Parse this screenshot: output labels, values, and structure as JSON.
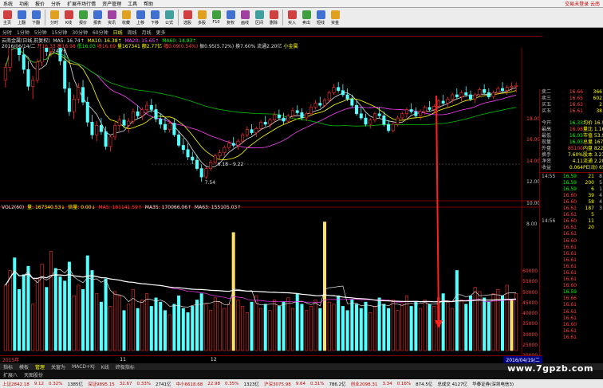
{
  "menu": {
    "items": [
      "系统",
      "功能",
      "报价",
      "分析",
      "扩展市场行情",
      "资产管理",
      "工具",
      "帮助"
    ],
    "right": "交易未登录  云南"
  },
  "toolbar": {
    "buttons": [
      {
        "label": "主页",
        "color": "#d04040"
      },
      {
        "label": "上翻",
        "color": "#4070d0"
      },
      {
        "label": "下翻",
        "color": "#4070d0"
      },
      {
        "label": "分时",
        "color": "#e0a020"
      },
      {
        "label": "K线",
        "color": "#d04040"
      },
      {
        "label": "报价",
        "color": "#40a040"
      },
      {
        "label": "报表",
        "color": "#4070d0"
      },
      {
        "label": "资讯",
        "color": "#a040a0"
      },
      {
        "label": "收藏",
        "color": "#e0a020"
      },
      {
        "label": "上移",
        "color": "#4070d0"
      },
      {
        "label": "下移",
        "color": "#4070d0"
      },
      {
        "label": "公式",
        "color": "#40a0a0"
      },
      {
        "label": "选股",
        "color": "#d04040"
      },
      {
        "label": "多股",
        "color": "#e0a020"
      },
      {
        "label": "F10",
        "color": "#40a040"
      },
      {
        "label": "复权",
        "color": "#4070d0"
      },
      {
        "label": "画线",
        "color": "#a040a0"
      },
      {
        "label": "区间",
        "color": "#40a0a0"
      },
      {
        "label": "删除",
        "color": "#d04040"
      },
      {
        "label": "买入",
        "color": "#d04040"
      },
      {
        "label": "卖出",
        "color": "#40a040"
      },
      {
        "label": "短线",
        "color": "#4070d0"
      },
      {
        "label": "资金",
        "color": "#e0a020"
      }
    ]
  },
  "periods": [
    "分时",
    "1分钟",
    "5分钟",
    "15分钟",
    "30分钟",
    "60分钟",
    "日线",
    "周线",
    "月线",
    "更多"
  ],
  "info": {
    "line1_name": "云南金属(日线,前复权)",
    "ma5": "MA5: 16.74↑",
    "ma10": "MA10: 16.38↑",
    "ma20": "MA20: 15.65↑",
    "ma60": "MA60: 14.93↑",
    "line2_date": "2016/06/14/二",
    "open": "开16.33",
    "high": "高16.98",
    "low": "低16.03",
    "close": "收16.69",
    "vol": "量167341",
    "amount": "额2.77亿",
    "chg": "幅0.09(0.54%)",
    "amp": "振0.95(5.72%)",
    "turn": "换7.60%",
    "flow": "流通2.20亿",
    "tag": "小金属"
  },
  "chart_labels": {
    "high_mark": "24.76",
    "low_mark": "7.54",
    "range_mark": "6.18 - 9.22"
  },
  "price_axis": [
    "18.00",
    "16.00",
    "14.00",
    "12.00",
    "10.00",
    "8.00"
  ],
  "vol_axis": [
    "60000",
    "55000",
    "50000",
    "45000",
    "40000",
    "35000",
    "30000",
    "25000",
    "20000",
    "15000",
    "10000"
  ],
  "vol_info": {
    "label": "VOL2(60)",
    "vol": "量: 167340.53↓",
    "ratio": "倍量: 0.00↓",
    "ma5": "MA5: 181141.59↑",
    "ma35": "MA35: 170066.06↑",
    "ma63": "MA63: 155105.03↑"
  },
  "quote": [
    {
      "k": "卖二",
      "v": "16.66",
      "n": "366",
      "vc": "#ff4040"
    },
    {
      "k": "卖三",
      "v": "16.65",
      "n": "602",
      "vc": "#ff4040"
    },
    {
      "k": "买五",
      "v": "16.63",
      "n": "2",
      "vc": "#ff4040"
    },
    {
      "k": "买五",
      "v": "16.61",
      "n": "38",
      "vc": "#ff4040"
    },
    {
      "k": "",
      "v": "",
      "n": "",
      "vc": "#000"
    },
    {
      "k": "今开",
      "v": "16.33",
      "n": "均价 16.53",
      "vc": "#00ff00"
    },
    {
      "k": "最高",
      "v": "16.98",
      "n": "量比 1.16",
      "vc": "#ff4040"
    },
    {
      "k": "最低",
      "v": "16.03",
      "n": "市值 53.9亿",
      "vc": "#00ff00"
    },
    {
      "k": "现量",
      "v": "16.03",
      "n": "总量 167340",
      "vc": "#00ff00"
    },
    {
      "k": "外盘",
      "v": "85100",
      "n": "内盘 82240",
      "vc": "#ff4040"
    },
    {
      "k": "换手",
      "v": "7.60%",
      "n": "股本 3.23亿",
      "vc": "#ffff00"
    },
    {
      "k": "净资",
      "v": "4.11",
      "n": "流通 2.20亿",
      "vc": "#ffff00"
    },
    {
      "k": "收益",
      "v": "0.064",
      "n": "PE(动) 65.4",
      "vc": "#ffff00"
    }
  ],
  "ticks": [
    {
      "t": "14:55",
      "p": "16.59",
      "q": "21",
      "s": "8",
      "pc": "#00ff00"
    },
    {
      "t": "",
      "p": "16.59",
      "q": "200",
      "s": "5",
      "pc": "#00ff00"
    },
    {
      "t": "",
      "p": "16.59",
      "q": "6",
      "s": "1",
      "pc": "#00ff00"
    },
    {
      "t": "",
      "p": "16.60",
      "q": "39",
      "s": "4",
      "pc": "#ff4040"
    },
    {
      "t": "",
      "p": "16.60",
      "q": "58",
      "s": "4",
      "pc": "#ff4040"
    },
    {
      "t": "",
      "p": "16.61",
      "q": "187",
      "s": "3",
      "pc": "#ff4040"
    },
    {
      "t": "",
      "p": "16.61",
      "q": "5",
      "s": "",
      "pc": "#ff4040"
    },
    {
      "t": "14:56",
      "p": "16.60",
      "q": "11",
      "s": "",
      "pc": "#ff4040"
    },
    {
      "t": "",
      "p": "16.61",
      "q": "20",
      "s": "",
      "pc": "#ff4040"
    },
    {
      "t": "",
      "p": "16.61",
      "q": "",
      "s": "",
      "pc": "#ff4040"
    },
    {
      "t": "",
      "p": "16.60",
      "q": "",
      "s": "",
      "pc": "#ff4040"
    },
    {
      "t": "",
      "p": "16.61",
      "q": "",
      "s": "",
      "pc": "#ff4040"
    },
    {
      "t": "",
      "p": "16.61",
      "q": "",
      "s": "",
      "pc": "#ff4040"
    },
    {
      "t": "",
      "p": "16.61",
      "q": "",
      "s": "",
      "pc": "#ff4040"
    },
    {
      "t": "",
      "p": "16.61",
      "q": "",
      "s": "",
      "pc": "#ff4040"
    },
    {
      "t": "",
      "p": "16.61",
      "q": "",
      "s": "",
      "pc": "#ff4040"
    },
    {
      "t": "",
      "p": "16.61",
      "q": "",
      "s": "",
      "pc": "#ff4040"
    },
    {
      "t": "",
      "p": "16.60",
      "q": "",
      "s": "",
      "pc": "#ff4040"
    },
    {
      "t": "",
      "p": "16.59",
      "q": "",
      "s": "",
      "pc": "#00ff00"
    },
    {
      "t": "",
      "p": "16.66",
      "q": "",
      "s": "",
      "pc": "#ff4040"
    },
    {
      "t": "",
      "p": "16.61",
      "q": "",
      "s": "",
      "pc": "#ff4040"
    },
    {
      "t": "",
      "p": "16.61",
      "q": "",
      "s": "",
      "pc": "#ff4040"
    },
    {
      "t": "",
      "p": "16.61",
      "q": "",
      "s": "",
      "pc": "#ff4040"
    },
    {
      "t": "",
      "p": "16.60",
      "q": "",
      "s": "",
      "pc": "#ff4040"
    },
    {
      "t": "",
      "p": "16.61",
      "q": "",
      "s": "",
      "pc": "#ff4040"
    },
    {
      "t": "",
      "p": "16.61",
      "q": "",
      "s": "",
      "pc": "#ff4040"
    }
  ],
  "bottom": {
    "left": "2015年",
    "mid1": "11",
    "mid2": "12",
    "right": "2016/04/19/二"
  },
  "tabs": [
    "指标",
    "模板",
    "管理",
    "关窗为",
    "MACD+KJ",
    "K线",
    "终极指标"
  ],
  "tabs2": [
    "扩展八",
    "天图股份"
  ],
  "status": [
    {
      "t": "上证2842.18",
      "c": "r"
    },
    {
      "t": "9.12",
      "c": "r"
    },
    {
      "t": "0.32%",
      "c": "r"
    },
    {
      "t": "1385亿",
      "c": ""
    },
    {
      "t": "深证9895.15",
      "c": "r"
    },
    {
      "t": "32.67",
      "c": "r"
    },
    {
      "t": "0.33%",
      "c": "r"
    },
    {
      "t": "2741亿",
      "c": ""
    },
    {
      "t": "中小6618.68",
      "c": "r"
    },
    {
      "t": "22.98",
      "c": "r"
    },
    {
      "t": "0.35%",
      "c": "r"
    },
    {
      "t": "1323亿",
      "c": ""
    },
    {
      "t": "沪深3075.98",
      "c": "r"
    },
    {
      "t": "9.64",
      "c": "r"
    },
    {
      "t": "0.31%",
      "c": "r"
    },
    {
      "t": "786.2亿",
      "c": ""
    },
    {
      "t": "创业2098.31",
      "c": "r"
    },
    {
      "t": "3.34",
      "c": "r"
    },
    {
      "t": "0.16%",
      "c": "r"
    },
    {
      "t": "874.5亿",
      "c": ""
    },
    {
      "t": "总成交 4127亿",
      "c": ""
    },
    {
      "t": "华泰证券(深圳电信3)",
      "c": ""
    }
  ],
  "watermark": "www.7gpzb.com",
  "colors": {
    "up": "#ff3030",
    "down": "#54ffff",
    "ma5": "#e0e0e0",
    "ma10": "#ffff00",
    "ma20": "#ff40ff",
    "ma60": "#00c000",
    "vol_hl": "#ffe066"
  },
  "chart_data": {
    "type": "candlestick",
    "price_range": [
      6.5,
      19.5
    ],
    "vol_range": [
      0,
      65000
    ],
    "candles": [
      [
        17.2,
        18.8,
        16.5,
        18.4
      ],
      [
        18.4,
        22.0,
        18.0,
        21.5
      ],
      [
        21.5,
        23.5,
        20.2,
        20.8
      ],
      [
        20.8,
        22.2,
        19.0,
        19.6
      ],
      [
        19.6,
        20.6,
        17.8,
        18.2
      ],
      [
        18.2,
        19.0,
        16.2,
        16.6
      ],
      [
        16.6,
        17.6,
        15.4,
        17.2
      ],
      [
        17.2,
        19.2,
        16.9,
        18.9
      ],
      [
        18.9,
        21.2,
        18.5,
        20.8
      ],
      [
        20.8,
        21.8,
        19.5,
        19.9
      ],
      [
        19.9,
        24.76,
        19.4,
        23.8
      ],
      [
        23.8,
        24.3,
        21.0,
        21.5
      ],
      [
        21.5,
        22.0,
        18.6,
        19.0
      ],
      [
        19.0,
        19.8,
        16.0,
        16.4
      ],
      [
        16.4,
        17.0,
        13.8,
        14.2
      ],
      [
        14.2,
        15.8,
        13.5,
        15.4
      ],
      [
        15.4,
        16.9,
        15.0,
        16.5
      ],
      [
        16.5,
        17.2,
        14.8,
        15.1
      ],
      [
        15.1,
        15.6,
        12.8,
        13.2
      ],
      [
        13.2,
        13.9,
        11.6,
        12.0
      ],
      [
        12.0,
        13.3,
        11.4,
        12.9
      ],
      [
        12.9,
        13.6,
        12.0,
        12.3
      ],
      [
        12.3,
        12.8,
        10.6,
        10.9
      ],
      [
        10.9,
        12.0,
        10.4,
        11.8
      ],
      [
        11.8,
        13.2,
        11.5,
        12.9
      ],
      [
        12.9,
        13.8,
        12.4,
        13.4
      ],
      [
        13.4,
        14.0,
        12.6,
        12.9
      ],
      [
        12.9,
        13.6,
        12.2,
        13.3
      ],
      [
        13.3,
        14.5,
        13.0,
        14.2
      ],
      [
        14.2,
        14.8,
        13.5,
        13.8
      ],
      [
        13.8,
        14.6,
        13.4,
        14.4
      ],
      [
        14.4,
        15.2,
        14.0,
        14.8
      ],
      [
        14.8,
        15.4,
        14.1,
        14.4
      ],
      [
        14.4,
        14.9,
        13.2,
        13.5
      ],
      [
        13.5,
        14.0,
        12.6,
        13.0
      ],
      [
        13.0,
        13.6,
        12.2,
        12.5
      ],
      [
        12.5,
        13.4,
        12.2,
        13.1
      ],
      [
        13.1,
        13.5,
        11.8,
        12.0
      ],
      [
        12.0,
        12.4,
        10.8,
        11.0
      ],
      [
        11.0,
        11.7,
        10.2,
        10.6
      ],
      [
        10.6,
        11.2,
        9.6,
        9.9
      ],
      [
        9.9,
        10.4,
        9.22,
        9.6
      ],
      [
        9.6,
        10.1,
        8.6,
        8.8
      ],
      [
        8.8,
        9.2,
        7.54,
        8.0
      ],
      [
        8.0,
        9.0,
        7.8,
        8.8
      ],
      [
        8.8,
        9.6,
        8.6,
        9.4
      ],
      [
        9.4,
        10.2,
        9.2,
        10.0
      ],
      [
        10.0,
        10.6,
        9.6,
        10.3
      ],
      [
        10.3,
        11.0,
        10.0,
        10.8
      ],
      [
        10.8,
        11.5,
        10.5,
        11.2
      ],
      [
        11.2,
        11.8,
        10.8,
        11.0
      ],
      [
        11.0,
        11.6,
        10.6,
        11.4
      ],
      [
        11.4,
        12.2,
        11.2,
        12.0
      ],
      [
        12.0,
        12.8,
        11.8,
        12.5
      ],
      [
        12.5,
        13.0,
        12.0,
        12.2
      ],
      [
        12.2,
        12.8,
        11.8,
        12.6
      ],
      [
        12.6,
        13.4,
        12.4,
        13.2
      ],
      [
        13.2,
        13.8,
        12.8,
        13.0
      ],
      [
        13.0,
        13.6,
        12.6,
        13.4
      ],
      [
        13.4,
        14.2,
        13.2,
        13.9
      ],
      [
        13.9,
        14.4,
        13.4,
        13.6
      ],
      [
        13.6,
        14.1,
        13.0,
        13.3
      ],
      [
        13.3,
        14.0,
        13.1,
        13.8
      ],
      [
        13.8,
        14.6,
        13.6,
        14.3
      ],
      [
        14.3,
        14.8,
        13.9,
        14.1
      ],
      [
        14.1,
        14.5,
        13.4,
        13.6
      ],
      [
        13.6,
        14.2,
        13.3,
        14.0
      ],
      [
        14.0,
        14.9,
        13.8,
        14.6
      ],
      [
        14.6,
        15.3,
        14.4,
        15.0
      ],
      [
        15.0,
        15.6,
        14.6,
        14.8
      ],
      [
        14.8,
        15.5,
        14.6,
        15.3
      ],
      [
        15.3,
        16.2,
        15.1,
        16.0
      ],
      [
        16.0,
        16.8,
        15.8,
        16.5
      ],
      [
        16.5,
        17.0,
        16.0,
        16.2
      ],
      [
        16.2,
        16.8,
        15.6,
        15.8
      ],
      [
        15.8,
        16.4,
        15.2,
        15.4
      ],
      [
        15.4,
        15.8,
        14.6,
        14.8
      ],
      [
        14.8,
        15.2,
        13.8,
        14.0
      ],
      [
        14.0,
        14.6,
        13.4,
        13.6
      ],
      [
        13.6,
        14.0,
        12.8,
        13.0
      ],
      [
        13.0,
        13.6,
        12.6,
        13.4
      ],
      [
        13.4,
        14.2,
        13.2,
        14.0
      ],
      [
        14.0,
        14.6,
        13.6,
        13.8
      ],
      [
        13.8,
        14.2,
        12.8,
        13.0
      ],
      [
        13.0,
        13.4,
        12.2,
        12.4
      ],
      [
        12.4,
        13.2,
        12.2,
        13.0
      ],
      [
        13.0,
        13.8,
        12.8,
        13.6
      ],
      [
        13.6,
        14.2,
        13.4,
        14.0
      ],
      [
        14.0,
        14.6,
        13.6,
        14.4
      ],
      [
        14.4,
        15.0,
        14.0,
        14.2
      ],
      [
        14.2,
        14.6,
        13.6,
        13.8
      ],
      [
        13.8,
        14.4,
        13.4,
        14.2
      ],
      [
        14.2,
        14.8,
        13.9,
        14.6
      ],
      [
        14.6,
        15.2,
        14.2,
        14.4
      ],
      [
        14.4,
        14.9,
        14.0,
        14.7
      ],
      [
        14.7,
        15.4,
        14.5,
        15.2
      ],
      [
        15.2,
        15.8,
        14.8,
        15.0
      ],
      [
        15.0,
        15.6,
        14.6,
        15.4
      ],
      [
        15.4,
        16.0,
        15.0,
        15.8
      ],
      [
        15.8,
        16.4,
        15.4,
        15.6
      ],
      [
        15.6,
        16.2,
        15.2,
        16.0
      ],
      [
        16.0,
        16.6,
        15.6,
        15.8
      ],
      [
        15.8,
        16.2,
        15.2,
        15.4
      ],
      [
        15.4,
        16.0,
        15.0,
        15.8
      ],
      [
        15.8,
        16.5,
        15.6,
        16.3
      ],
      [
        16.3,
        16.8,
        15.8,
        16.0
      ],
      [
        16.0,
        16.4,
        15.4,
        15.6
      ],
      [
        15.6,
        16.2,
        15.4,
        16.0
      ],
      [
        16.0,
        16.6,
        15.8,
        16.4
      ],
      [
        16.4,
        17.0,
        16.0,
        16.2
      ],
      [
        16.2,
        16.7,
        15.8,
        16.5
      ],
      [
        16.5,
        16.98,
        16.2,
        16.6
      ],
      [
        16.6,
        16.98,
        16.03,
        16.69
      ]
    ],
    "volumes": [
      31000,
      38000,
      44000,
      29000,
      36000,
      40000,
      22000,
      34000,
      41000,
      30000,
      47000,
      39000,
      35000,
      33000,
      42000,
      26000,
      31000,
      29000,
      45000,
      38000,
      27000,
      23000,
      34000,
      21000,
      28000,
      26000,
      19000,
      22000,
      29000,
      20000,
      24000,
      27000,
      21000,
      25000,
      23000,
      19000,
      17000,
      22000,
      26000,
      20000,
      18000,
      21000,
      24000,
      27000,
      22000,
      19000,
      25000,
      23000,
      20000,
      22000,
      56000,
      24000,
      21000,
      18000,
      23000,
      26000,
      20000,
      22000,
      19000,
      24000,
      21000,
      23000,
      25000,
      20000,
      27000,
      22000,
      19000,
      21000,
      24000,
      20000,
      61000,
      23000,
      22000,
      26000,
      21000,
      19000,
      24000,
      22000,
      20000,
      23000,
      18000,
      21000,
      25000,
      22000,
      20000,
      24000,
      19000,
      22000,
      26000,
      21000,
      23000,
      20000,
      24000,
      22000,
      21000,
      25000,
      27000,
      23000,
      20000,
      38000,
      24000,
      22000,
      26000,
      30000,
      28000,
      25000,
      23000,
      27000,
      29000,
      26000,
      31000,
      24000,
      27000
    ],
    "highlight_volume_indices": [
      50,
      70,
      111
    ]
  }
}
